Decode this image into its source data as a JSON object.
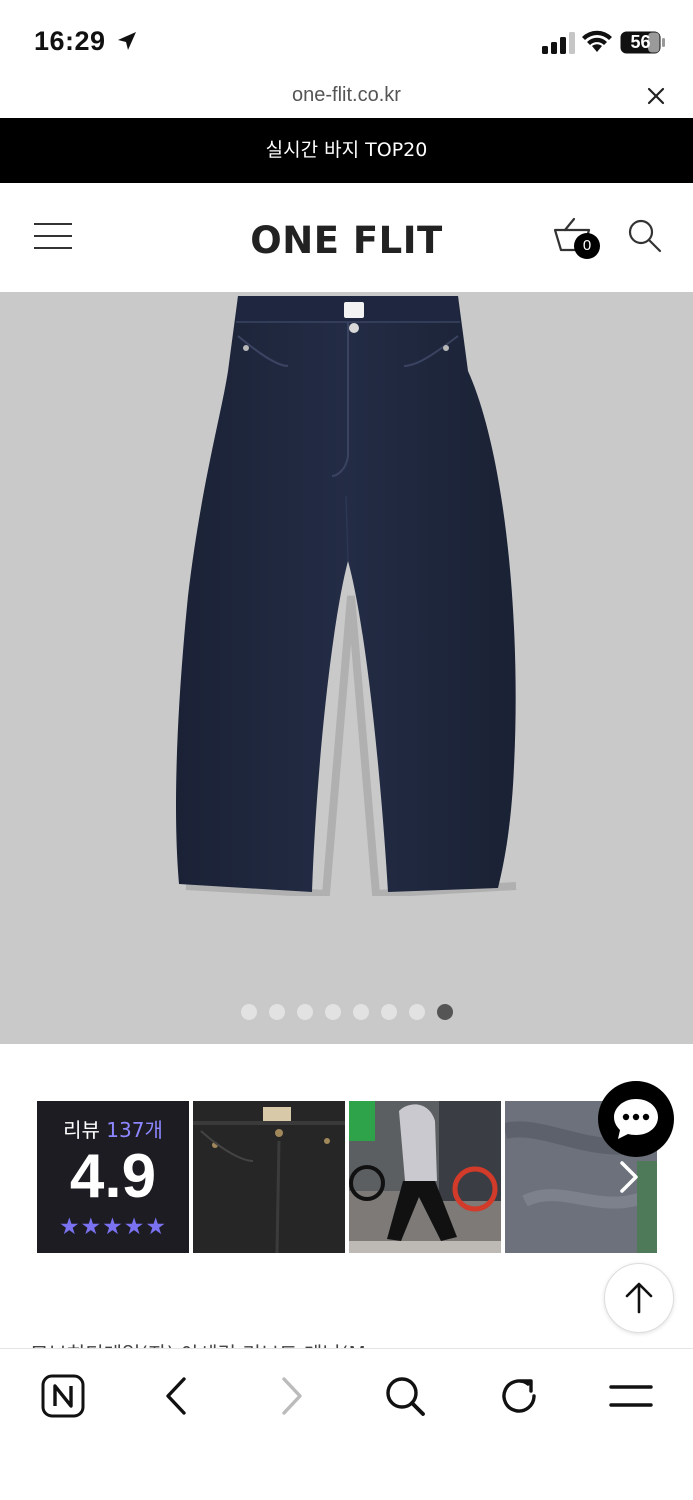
{
  "status_bar": {
    "time": "16:29",
    "battery": "56"
  },
  "browser": {
    "url": "one-flit.co.kr"
  },
  "banner": {
    "text": "실시간 바지 TOP20"
  },
  "header": {
    "logo": "ONE FLIT",
    "cart_count": "0"
  },
  "gallery": {
    "total_slides": 8,
    "active_slide": 8
  },
  "reviews": {
    "label_prefix": "리뷰 ",
    "count": "137개",
    "score": "4.9",
    "stars": "★★★★★"
  },
  "product": {
    "title_partial": "모보히디테일(자) 아세린 리브드 데님(M..."
  },
  "colors": {
    "banner_bg": "#000000",
    "image_bg": "#c9c9c9",
    "star_color": "#7b72f2",
    "review_count_color": "#8d86ff"
  }
}
